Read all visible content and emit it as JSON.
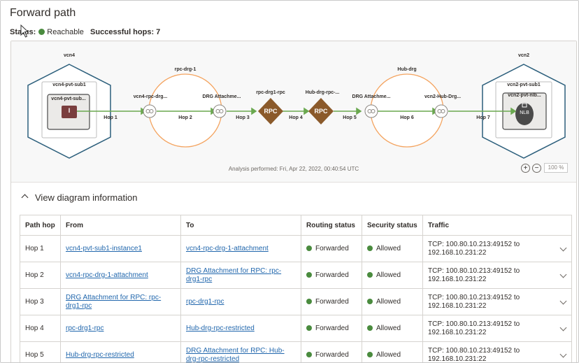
{
  "page": {
    "title": "Forward path",
    "status_label": "Status:",
    "status_value": "Reachable",
    "status_color": "#4a8b3e",
    "hops_label": "Successful hops: 7"
  },
  "diagram": {
    "labels": {
      "vcn4": "vcn4",
      "vcn4_sub": "vcn4-pvt-sub1",
      "vcn4_inst": "vcn4-pvt-sub...",
      "inst_glyph": "I",
      "att1": "vcn4-rpc-drg...",
      "drg1": "rpc-drg-1",
      "att2": "DRG Attachme...",
      "rpc1": "rpc-drg1-rpc",
      "rpc2": "Hub-drg-rpc-...",
      "rpc_glyph": "RPC",
      "drg2": "Hub-drg",
      "att3": "DRG Attachme...",
      "att4": "vcn2-Hub-Drg...",
      "vcn2": "vcn2",
      "vcn2_sub": "vcn2-pvt-sub1",
      "vcn2_nlb": "vcn2-pvt-nlb...",
      "nlb_glyph": "NLB",
      "hop1": "Hop 1",
      "hop2": "Hop 2",
      "hop3": "Hop 3",
      "hop4": "Hop 4",
      "hop5": "Hop 5",
      "hop6": "Hop 6",
      "hop7": "Hop 7"
    },
    "analysis": "Analysis performed: Fri, Apr 22, 2022, 00:40:54 UTC",
    "zoom_in": "+",
    "zoom_out": "−",
    "zoom_level": "100 %",
    "colors": {
      "hex": "#2c5f7c",
      "drg": "#f4a460",
      "path": "#6aa84f",
      "rpc": "#8b5a2b",
      "inst": "#7a3e3e"
    }
  },
  "info": {
    "toggle_label": "View diagram information",
    "columns": [
      "Path hop",
      "From",
      "To",
      "Routing status",
      "Security status",
      "Traffic"
    ],
    "rows": [
      {
        "hop": "Hop 1",
        "from": "vcn4-pvt-sub1-instance1",
        "to": "vcn4-rpc-drg-1-attachment",
        "routing": "Forwarded",
        "security": "Allowed",
        "traffic": "TCP: 100.80.10.213:49152 to 192.168.10.231:22"
      },
      {
        "hop": "Hop 2",
        "from": "vcn4-rpc-drg-1-attachment",
        "to": "DRG Attachment for RPC: rpc-drg1-rpc",
        "routing": "Forwarded",
        "security": "Allowed",
        "traffic": "TCP: 100.80.10.213:49152 to 192.168.10.231:22"
      },
      {
        "hop": "Hop 3",
        "from": "DRG Attachment for RPC: rpc-drg1-rpc",
        "to": "rpc-drg1-rpc",
        "routing": "Forwarded",
        "security": "Allowed",
        "traffic": "TCP: 100.80.10.213:49152 to 192.168.10.231:22"
      },
      {
        "hop": "Hop 4",
        "from": "rpc-drg1-rpc",
        "to": "Hub-drg-rpc-restricted",
        "routing": "Forwarded",
        "security": "Allowed",
        "traffic": "TCP: 100.80.10.213:49152 to 192.168.10.231:22"
      },
      {
        "hop": "Hop 5",
        "from": "Hub-drg-rpc-restricted",
        "to": "DRG Attachment for RPC: Hub-drg-rpc-restricted",
        "routing": "Forwarded",
        "security": "Allowed",
        "traffic": "TCP: 100.80.10.213:49152 to 192.168.10.231:22"
      }
    ]
  }
}
